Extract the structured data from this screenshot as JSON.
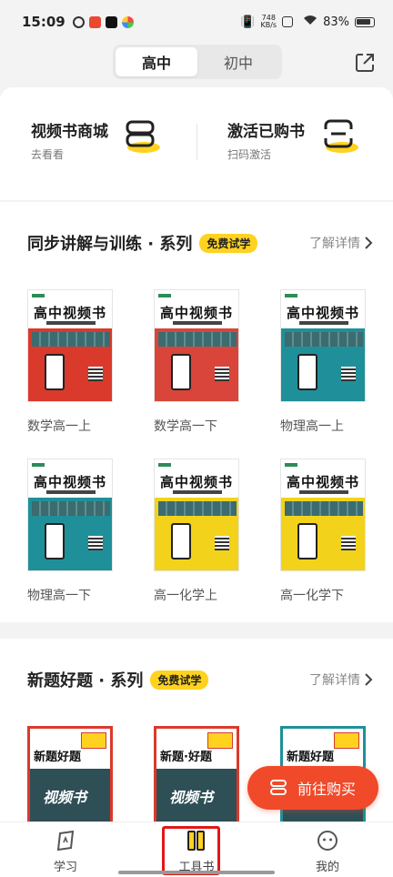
{
  "status_bar": {
    "time": "15:09",
    "network_speed_value": "748",
    "network_speed_unit": "KB/s",
    "battery": "83%"
  },
  "header": {
    "tabs": [
      {
        "label": "高中",
        "active": true
      },
      {
        "label": "初中",
        "active": false
      }
    ]
  },
  "entry": {
    "left": {
      "title": "视频书商城",
      "subtitle": "去看看"
    },
    "right": {
      "title": "激活已购书",
      "subtitle": "扫码激活"
    }
  },
  "section1": {
    "title": "同步讲解与训练 · 系列",
    "badge": "免费试学",
    "more": "了解详情",
    "books": [
      {
        "label": "数学高一上",
        "color": "#d93a2b",
        "cover_title": "高中视频书"
      },
      {
        "label": "数学高一下",
        "color": "#d9453a",
        "cover_title": "高中视频书"
      },
      {
        "label": "物理高一上",
        "color": "#1f9099",
        "cover_title": "高中视频书"
      },
      {
        "label": "物理高一下",
        "color": "#1f9099",
        "cover_title": "高中视频书"
      },
      {
        "label": "高一化学上",
        "color": "#f2d21a",
        "cover_title": "高中视频书"
      },
      {
        "label": "高一化学下",
        "color": "#f2d21a",
        "cover_title": "高中视频书"
      }
    ]
  },
  "section2": {
    "title": "新题好题 · 系列",
    "badge": "免费试学",
    "more": "了解详情",
    "books": [
      {
        "cover_title": "新题好题",
        "cover_word": "视频书",
        "border": "#d93a2b"
      },
      {
        "cover_title": "新题·好题",
        "cover_word": "视频书",
        "border": "#d93a2b"
      },
      {
        "cover_title": "新题好题",
        "cover_word": "",
        "border": "#1f9099"
      }
    ]
  },
  "buy_button": {
    "label": "前往购买"
  },
  "bottom_nav": [
    {
      "label": "学习",
      "icon": "learn-icon"
    },
    {
      "label": "工具书",
      "icon": "toolbook-icon",
      "active": true
    },
    {
      "label": "我的",
      "icon": "profile-icon"
    }
  ],
  "colors": {
    "accent_yellow": "#ffd21f",
    "buy_red": "#f04a2a",
    "highlight_red": "#e01818"
  }
}
